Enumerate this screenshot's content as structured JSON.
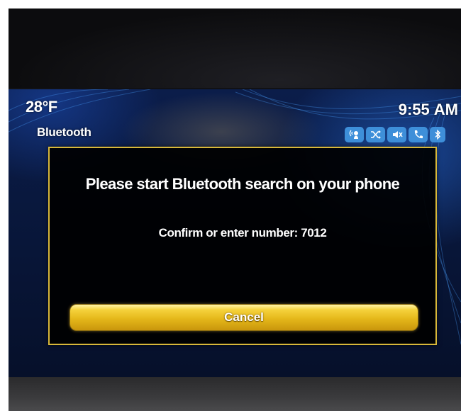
{
  "status_bar": {
    "temperature": "28°F",
    "source": "Bluetooth",
    "time": "9:55",
    "meridiem": "AM",
    "icons": [
      "voice-recognition-icon",
      "shuffle-icon",
      "mute-icon",
      "phone-icon",
      "bluetooth-icon"
    ]
  },
  "dialog": {
    "title": "Please start Bluetooth search on your phone",
    "message": "Confirm or enter number: 7012",
    "cancel_label": "Cancel"
  },
  "colors": {
    "accent_yellow": "#e5b81a",
    "icon_blue": "#3e8fd9",
    "dialog_border": "#d8b83a"
  }
}
